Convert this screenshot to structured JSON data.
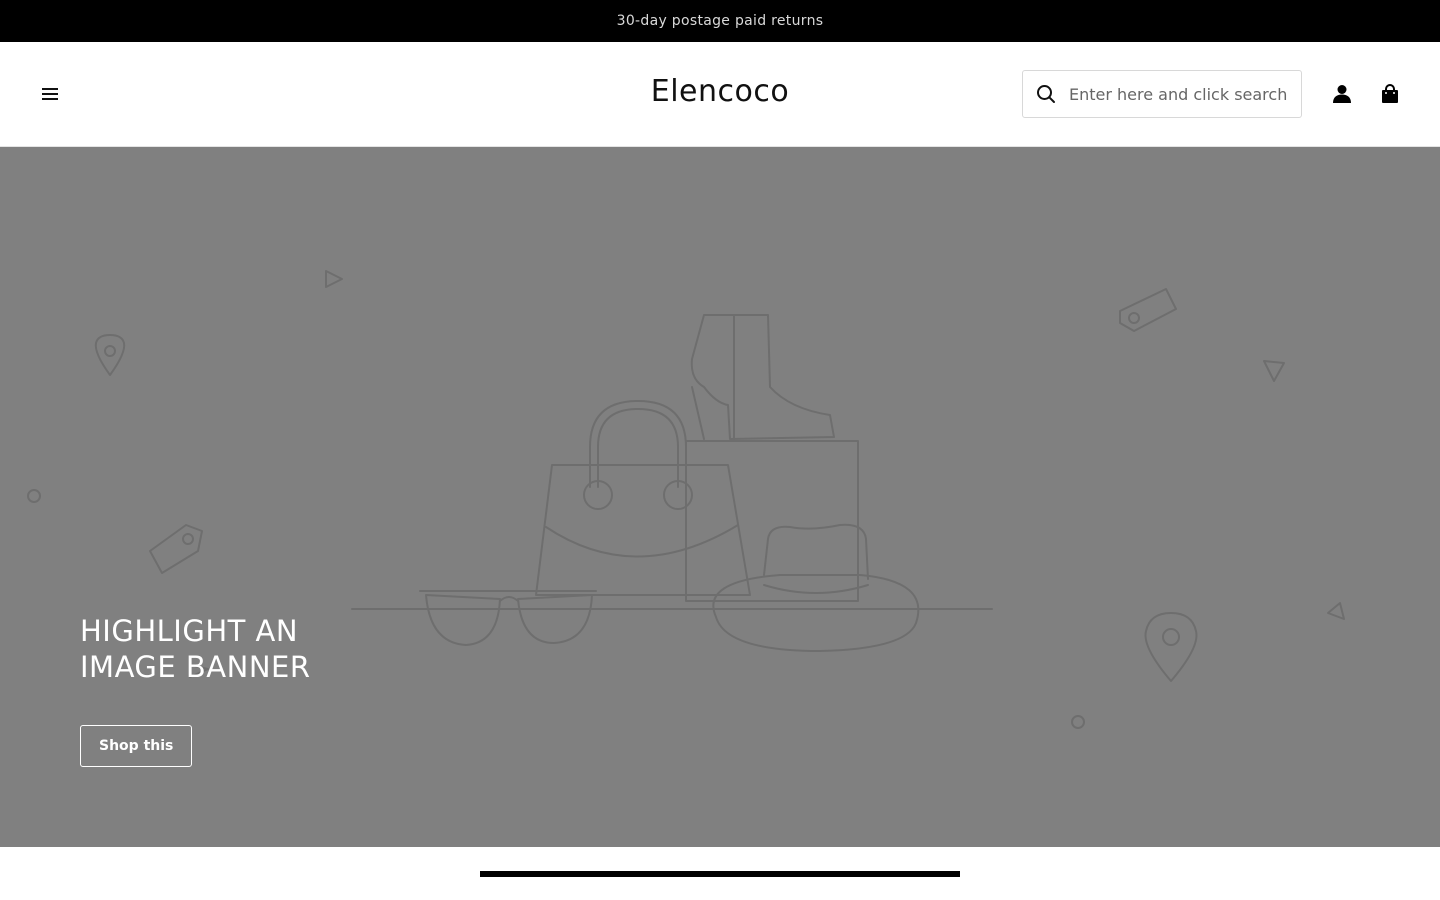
{
  "announcement": {
    "text": "30-day postage paid returns"
  },
  "header": {
    "menu_icon": "hamburger-icon",
    "logo": "Elencoco",
    "search": {
      "placeholder": "Enter here and click search",
      "value": "",
      "icon": "search-icon"
    },
    "account_icon": "user-icon",
    "cart_icon": "shopping-bag-icon"
  },
  "hero": {
    "title": "HIGHLIGHT AN IMAGE BANNER",
    "button_label": "Shop this",
    "background_color": "#808080",
    "illustration": "shopping-items-illustration"
  },
  "colors": {
    "announcement_bg": "#000000",
    "text_primary": "#111111",
    "hero_text": "#ffffff"
  }
}
